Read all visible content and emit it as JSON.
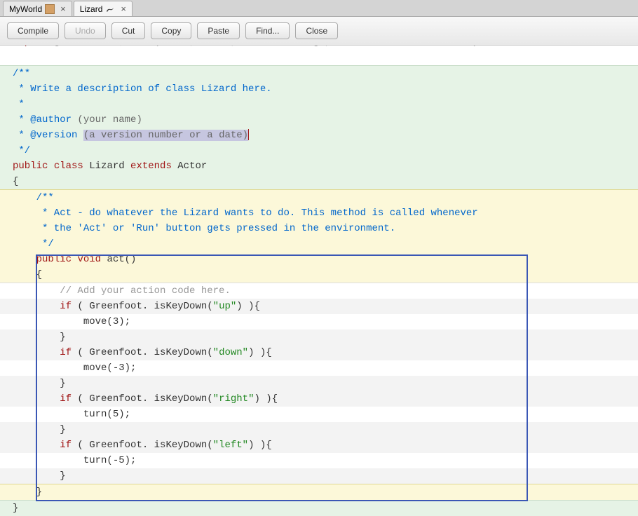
{
  "tabs": [
    {
      "label": "MyWorld"
    },
    {
      "label": "Lizard"
    }
  ],
  "toolbar": {
    "compile": "Compile",
    "undo": "Undo",
    "cut": "Cut",
    "copy": "Copy",
    "paste": "Paste",
    "find": "Find...",
    "close": "Close"
  },
  "code": {
    "import_kw": "import",
    "import_rest": " greenfoot.*;  ",
    "import_cmt": "// (World, Actor, GreenfootImage, Greenfoot and MouseInfo)",
    "doc1": "/**",
    "doc2": " * Write a description of class Lizard here.",
    "doc3": " * ",
    "doc4a": " * ",
    "doc4b": "@author",
    "doc4c": " (your name) ",
    "doc5a": " * ",
    "doc5b": "@version",
    "doc5c": " ",
    "doc5sel": "(a version number or a date)",
    "doc6": " */",
    "classline_pub": "public",
    "classline_cls": " class ",
    "classline_name": "Lizard ",
    "classline_ext": "extends",
    "classline_actor": " Actor",
    "lbrace": "{",
    "rbrace": "}",
    "mdoc1": "    /**",
    "mdoc2": "     * Act - do whatever the Lizard wants to do. This method is called whenever",
    "mdoc3": "     * the 'Act' or 'Run' button gets pressed in the environment.",
    "mdoc4": "     */",
    "msig_pre": "    ",
    "msig_pub": "public",
    "msig_sp": " ",
    "msig_void": "void",
    "msig_name": " act()",
    "mlbrace": "    {",
    "mrbrace": "    }",
    "addcmt": "        // Add your action code here.",
    "if1a": "        ",
    "if_kw": "if",
    "if1b": " ( Greenfoot. isKeyDown(",
    "str_up": "\"up\"",
    "if1c": ") ){",
    "move3": "            move(3);",
    "blk_close": "        }",
    "if2b": " ( Greenfoot. isKeyDown(",
    "str_down": "\"down\"",
    "if2c": ") ){",
    "movem3": "            move(-3);",
    "if3b": " ( Greenfoot. isKeyDown(",
    "str_right": "\"right\"",
    "if3c": ") ){",
    "turn5": "            turn(5);",
    "if4b": " ( Greenfoot. isKeyDown(",
    "str_left": "\"left\"",
    "if4c": ") ){",
    "turnm5": "            turn(-5);"
  }
}
